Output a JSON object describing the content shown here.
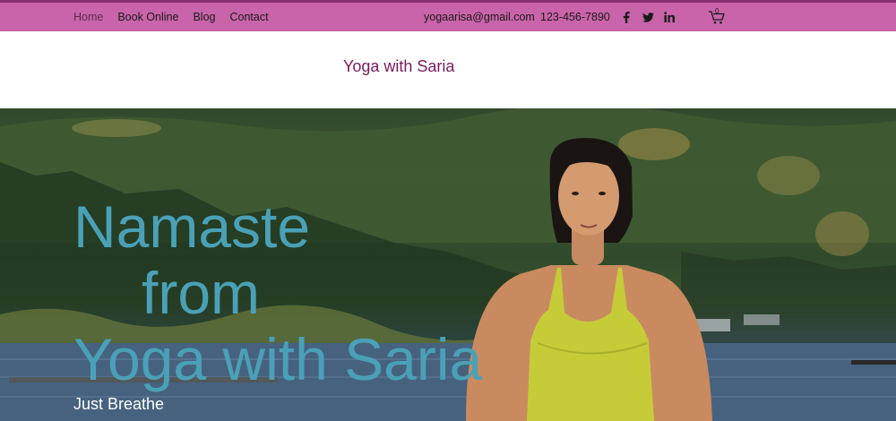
{
  "nav": {
    "items": [
      {
        "label": "Home",
        "active": true
      },
      {
        "label": "Book Online",
        "active": false
      },
      {
        "label": "Blog",
        "active": false
      },
      {
        "label": "Contact",
        "active": false
      }
    ]
  },
  "contact": {
    "email": "yogaarisa@gmail.com",
    "phone": "123-456-7890"
  },
  "social": [
    "facebook-icon",
    "twitter-icon",
    "linkedin-icon"
  ],
  "cart": {
    "count": "0"
  },
  "header": {
    "site_title": "Yoga with Saria"
  },
  "hero": {
    "headline_1": "Namaste",
    "headline_2": "from",
    "headline_3": "Yoga with Saria",
    "tagline": "Just Breathe"
  },
  "colors": {
    "topbar": "#c964aa",
    "topbar_border": "#8d2f73",
    "site_title": "#7a1a5e",
    "headline": "#4aa1b7"
  }
}
